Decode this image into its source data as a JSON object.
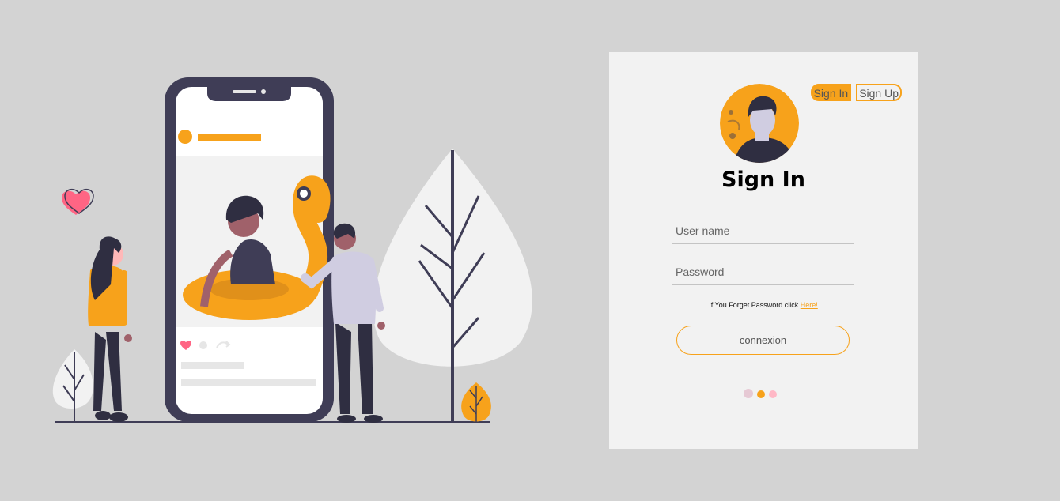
{
  "tabs": {
    "sign_in": "Sign In",
    "sign_up": "Sign Up"
  },
  "form": {
    "title": "Sign In",
    "username_placeholder": "User name",
    "password_placeholder": "Password",
    "forgot_text": "If You Forget Password click ",
    "forgot_link": "Here!",
    "submit_label": "connexion"
  },
  "colors": {
    "accent": "#f7a21b",
    "background": "#d3d3d3",
    "card": "#f2f2f2",
    "dark": "#3f3d56"
  },
  "icons": {
    "avatar": "user-avatar-icon",
    "heart": "heart-icon",
    "loader": "loading-dots-icon"
  }
}
